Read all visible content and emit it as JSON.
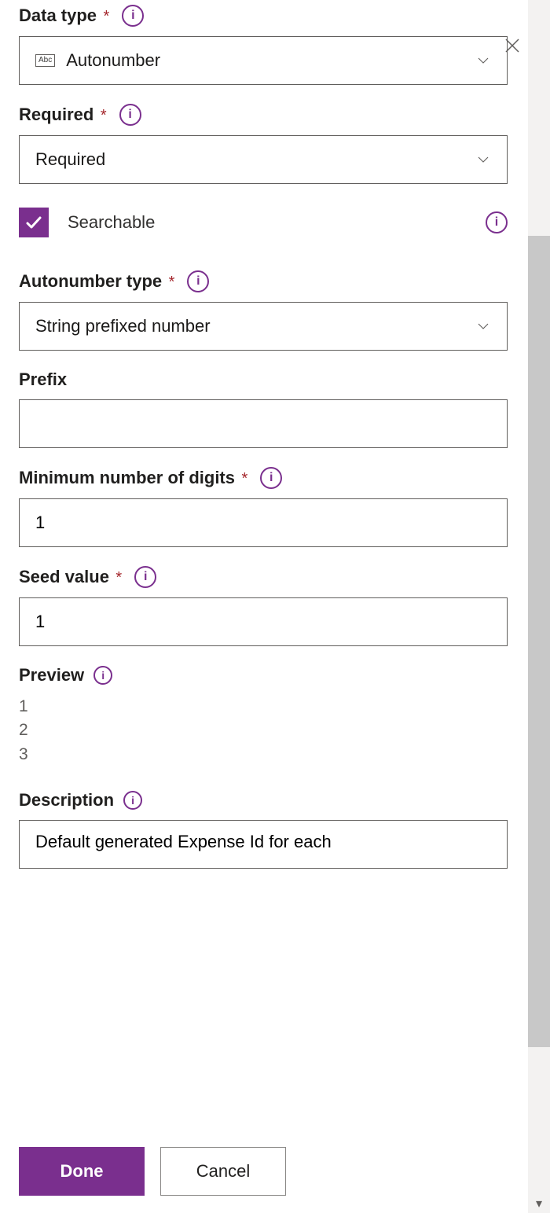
{
  "dataType": {
    "label": "Data type",
    "required": true,
    "value": "Autonumber",
    "iconText": "Abc"
  },
  "requiredField": {
    "label": "Required",
    "required": true,
    "value": "Required"
  },
  "searchable": {
    "label": "Searchable",
    "checked": true
  },
  "autonumberType": {
    "label": "Autonumber type",
    "required": true,
    "value": "String prefixed number"
  },
  "prefix": {
    "label": "Prefix",
    "required": false,
    "value": ""
  },
  "minDigits": {
    "label": "Minimum number of digits",
    "required": true,
    "value": "1"
  },
  "seed": {
    "label": "Seed value",
    "required": true,
    "value": "1"
  },
  "preview": {
    "label": "Preview",
    "items": [
      "1",
      "2",
      "3"
    ]
  },
  "description": {
    "label": "Description",
    "value": "Default generated Expense Id for each"
  },
  "buttons": {
    "done": "Done",
    "cancel": "Cancel"
  },
  "info": "i"
}
